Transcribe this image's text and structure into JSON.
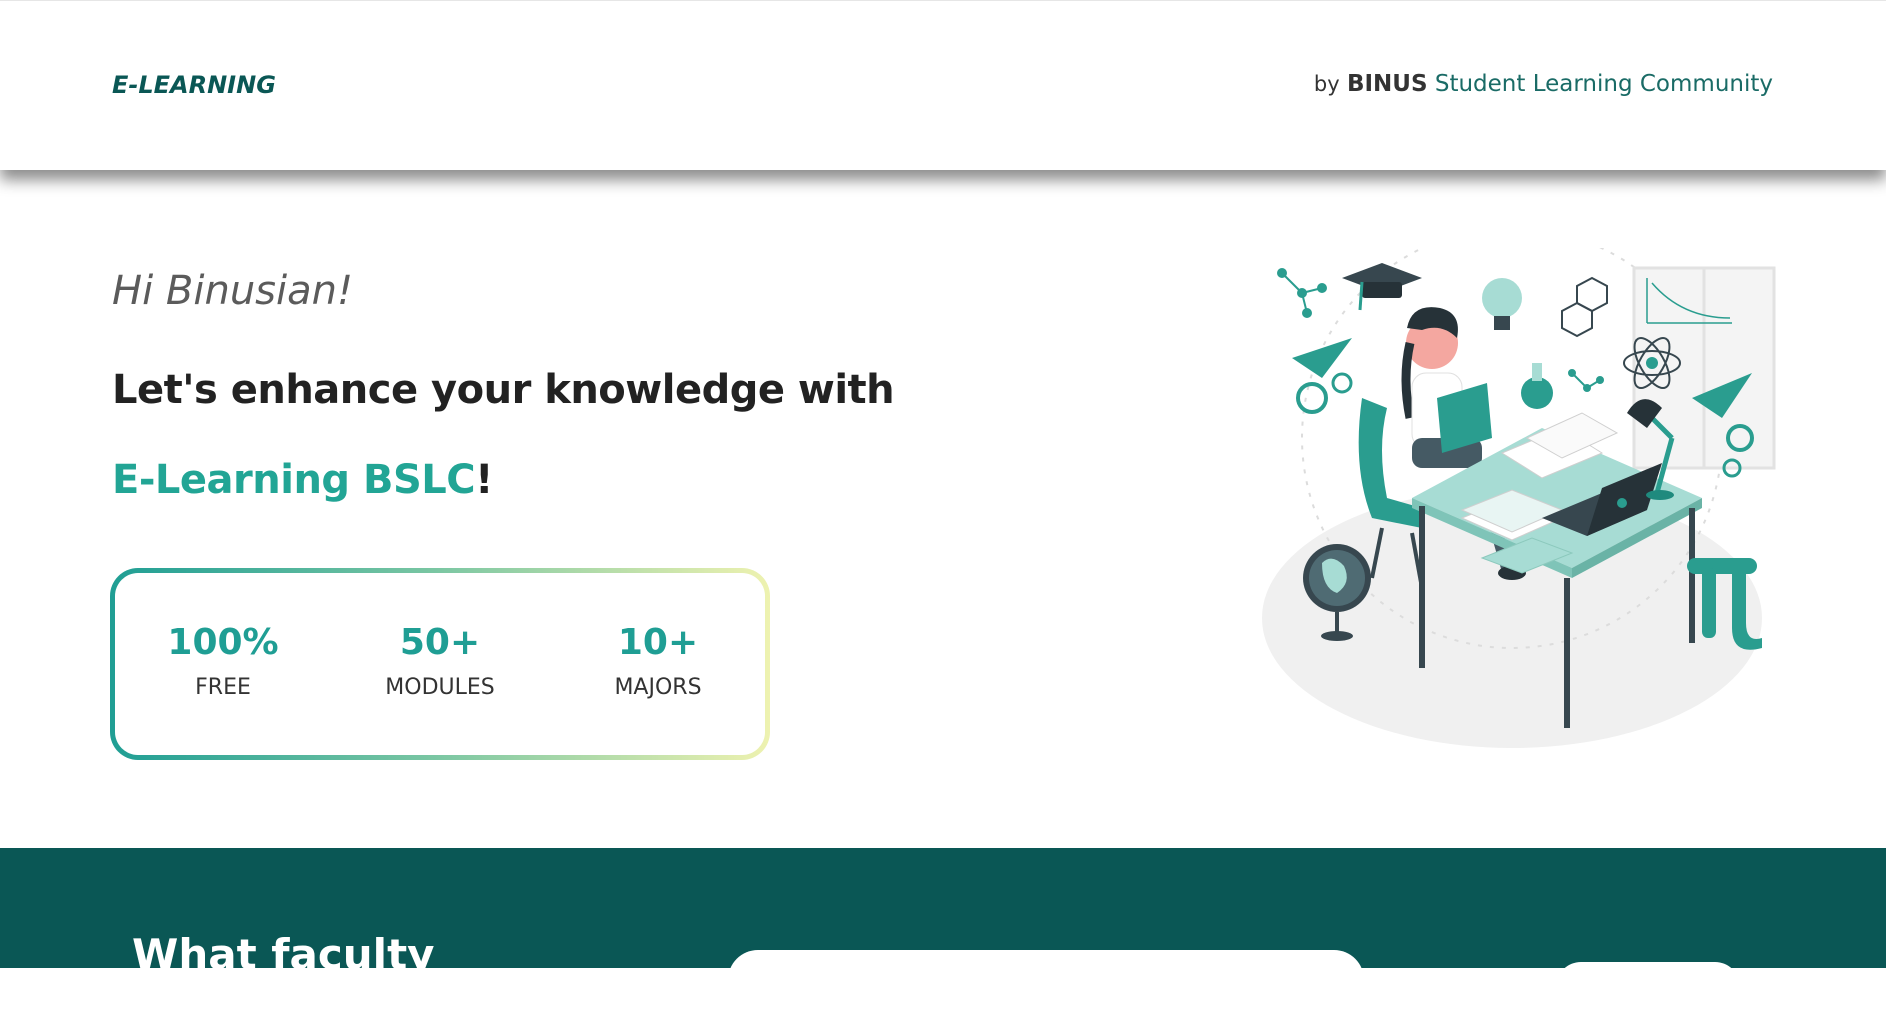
{
  "header": {
    "brand": "E-LEARNING",
    "org_by": "by",
    "org_binus": "BINUS",
    "org_rest": "Student Learning Community"
  },
  "hero": {
    "greeting": "Hi Binusian!",
    "headline_part1": "Let's enhance your knowledge with ",
    "headline_accent": "E-Learning BSLC",
    "headline_end": "!"
  },
  "stats": [
    {
      "value": "100%",
      "label": "FREE"
    },
    {
      "value": "50+",
      "label": "MODULES"
    },
    {
      "value": "10+",
      "label": "MAJORS"
    }
  ],
  "faculty_section": {
    "title": "What faculty"
  },
  "colors": {
    "primary_dark": "#0a5755",
    "accent": "#22a595",
    "gradient_start": "#1f9e94",
    "gradient_end": "#eef2b0"
  },
  "illustration": {
    "icon": "student-studying-illustration"
  }
}
